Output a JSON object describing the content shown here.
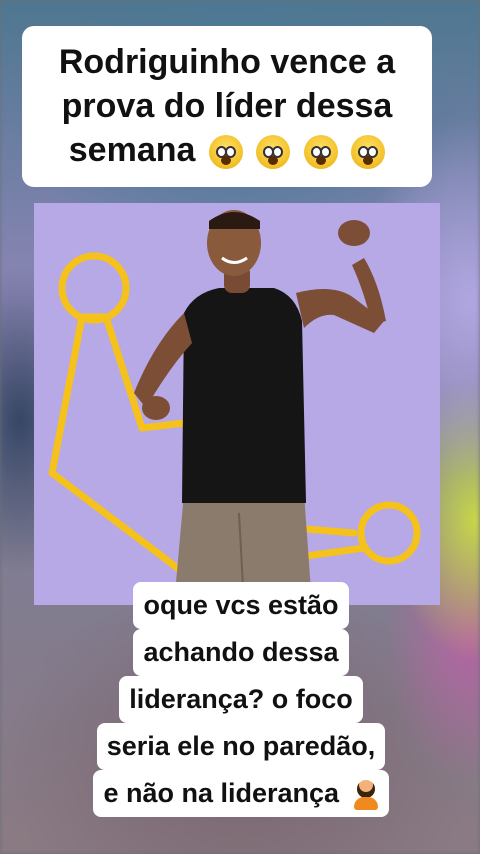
{
  "top_caption": {
    "line1": "Rodriguinho vence a",
    "line2": "prova do líder dessa",
    "line3": "semana",
    "emojis": [
      "face-screaming-in-fear-icon",
      "face-screaming-in-fear-icon",
      "face-screaming-in-fear-icon",
      "face-screaming-in-fear-icon"
    ]
  },
  "bottom_caption": {
    "lines": [
      "oque vcs estão",
      "achando dessa",
      "liderança? o foco",
      "seria ele no paredão,",
      "e não na liderança"
    ],
    "trailing_emoji": "person-facepalming-icon"
  },
  "colors": {
    "photo_background": "#b7a8e6",
    "crown_outline": "#f5c21b",
    "caption_background": "#ffffff"
  }
}
